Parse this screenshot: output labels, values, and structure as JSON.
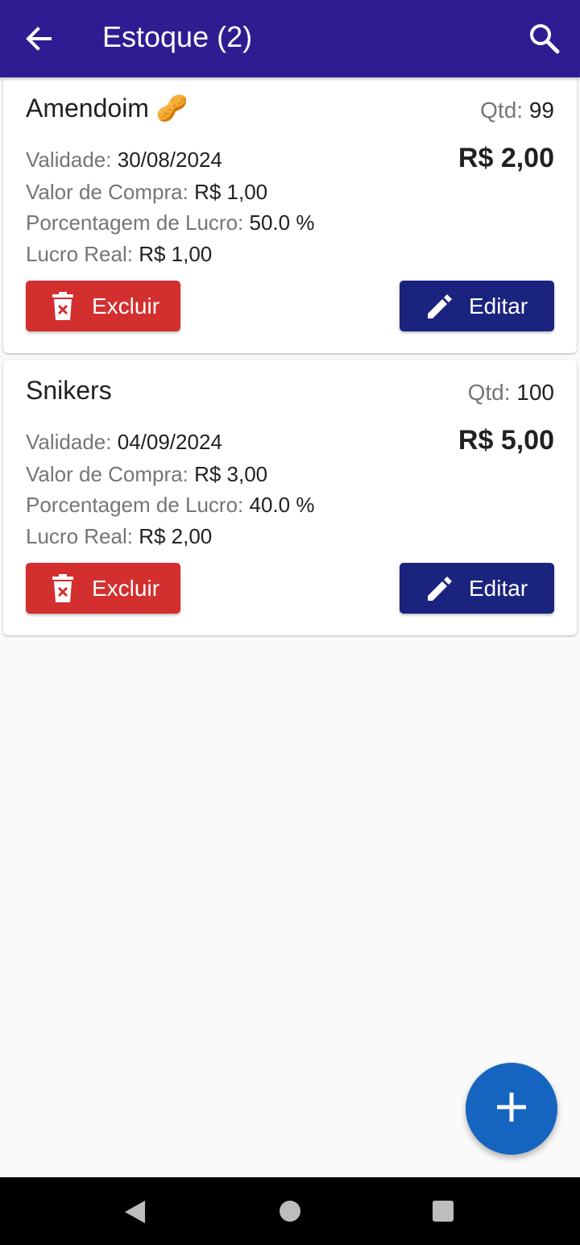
{
  "appbar": {
    "title": "Estoque (2)",
    "back_icon": "arrow-left-icon",
    "search_icon": "search-icon",
    "color": "#2e1c92"
  },
  "labels": {
    "validade": "Validade:",
    "valor_compra": "Valor de Compra:",
    "porcentagem": "Porcentagem de Lucro:",
    "lucro_real": "Lucro Real:",
    "qtd": "Qtd:"
  },
  "products": [
    {
      "name": "Amendoim 🥜",
      "qtd": "99",
      "price": "R$ 2,00",
      "validade": "30/08/2024",
      "valor_compra": "R$ 1,00",
      "porcentagem": "50.0 %",
      "lucro_real": "R$ 1,00",
      "delete_label": "Excluir",
      "edit_label": "Editar"
    },
    {
      "name": "Snikers",
      "qtd": "100",
      "price": "R$ 5,00",
      "validade": "04/09/2024",
      "valor_compra": "R$ 3,00",
      "porcentagem": "40.0 %",
      "lucro_real": "R$ 2,00",
      "delete_label": "Excluir",
      "edit_label": "Editar"
    }
  ],
  "colors": {
    "delete": "#d32f2f",
    "edit": "#1a237e",
    "fab": "#1565c0"
  },
  "fab_icon": "plus-icon",
  "system_nav": [
    "back-triangle-icon",
    "home-circle-icon",
    "recents-square-icon"
  ]
}
